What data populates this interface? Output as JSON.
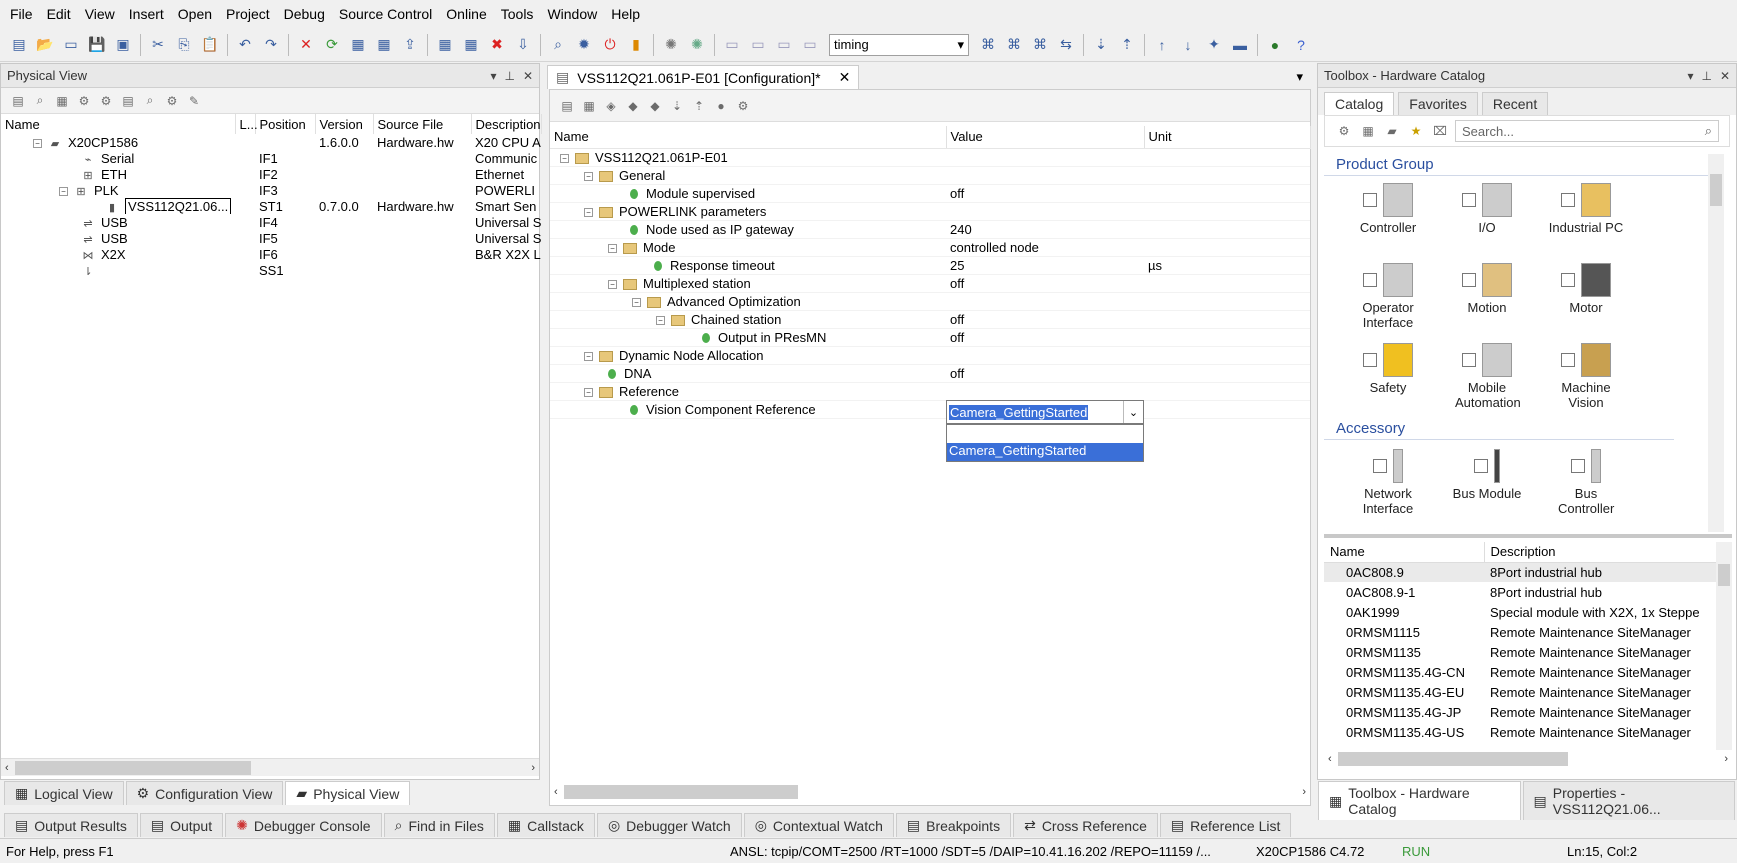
{
  "menu": [
    "File",
    "Edit",
    "View",
    "Insert",
    "Open",
    "Project",
    "Debug",
    "Source Control",
    "Online",
    "Tools",
    "Window",
    "Help"
  ],
  "toolbar": {
    "combo_value": "timing"
  },
  "physical_view": {
    "title": "Physical View",
    "columns": [
      "Name",
      "L...",
      "Position",
      "Version",
      "Source File",
      "Description"
    ],
    "rows": [
      {
        "name": "X20CP1586",
        "position": "",
        "version": "1.6.0.0",
        "source": "Hardware.hw",
        "desc": "X20 CPU A"
      },
      {
        "name": "Serial",
        "position": "IF1",
        "version": "",
        "source": "",
        "desc": "Communic"
      },
      {
        "name": "ETH",
        "position": "IF2",
        "version": "",
        "source": "",
        "desc": "Ethernet"
      },
      {
        "name": "PLK",
        "position": "IF3",
        "version": "",
        "source": "",
        "desc": "POWERLI"
      },
      {
        "name": "VSS112Q21.06...",
        "position": "ST1",
        "version": "0.7.0.0",
        "source": "Hardware.hw",
        "desc": "Smart Sen"
      },
      {
        "name": "USB",
        "position": "IF4",
        "version": "",
        "source": "",
        "desc": "Universal S"
      },
      {
        "name": "USB",
        "position": "IF5",
        "version": "",
        "source": "",
        "desc": "Universal S"
      },
      {
        "name": "X2X",
        "position": "IF6",
        "version": "",
        "source": "",
        "desc": "B&R X2X L"
      },
      {
        "name": "",
        "position": "SS1",
        "version": "",
        "source": "",
        "desc": ""
      }
    ],
    "tabs": [
      "Logical View",
      "Configuration View",
      "Physical View"
    ]
  },
  "config": {
    "tab_title": "VSS112Q21.061P-E01 [Configuration]*",
    "columns": [
      "Name",
      "Value",
      "Unit"
    ],
    "rows": [
      {
        "name": "VSS112Q21.061P-E01",
        "value": "",
        "unit": ""
      },
      {
        "name": "General",
        "value": "",
        "unit": ""
      },
      {
        "name": "Module supervised",
        "value": "off",
        "unit": ""
      },
      {
        "name": "POWERLINK parameters",
        "value": "",
        "unit": ""
      },
      {
        "name": "Node used as IP gateway",
        "value": "240",
        "unit": ""
      },
      {
        "name": "Mode",
        "value": "controlled node",
        "unit": ""
      },
      {
        "name": "Response timeout",
        "value": "25",
        "unit": "µs"
      },
      {
        "name": "Multiplexed station",
        "value": "off",
        "unit": ""
      },
      {
        "name": "Advanced Optimization",
        "value": "",
        "unit": ""
      },
      {
        "name": "Chained station",
        "value": "off",
        "unit": ""
      },
      {
        "name": "Output in PResMN",
        "value": "off",
        "unit": ""
      },
      {
        "name": "Dynamic Node Allocation",
        "value": "",
        "unit": ""
      },
      {
        "name": "DNA",
        "value": "off",
        "unit": ""
      },
      {
        "name": "Reference",
        "value": "",
        "unit": ""
      },
      {
        "name": "Vision Component Reference",
        "value": "",
        "unit": ""
      }
    ],
    "dropdown_value": "Camera_GettingStarted",
    "dropdown_options": [
      "",
      "Camera_GettingStarted"
    ]
  },
  "toolbox": {
    "title": "Toolbox - Hardware Catalog",
    "tabs": [
      "Catalog",
      "Favorites",
      "Recent"
    ],
    "search_placeholder": "Search...",
    "product_group_label": "Product Group",
    "accessory_label": "Accessory",
    "products": [
      "Controller",
      "I/O",
      "Industrial PC",
      "Operator Interface",
      "Motion",
      "Motor",
      "Safety",
      "Mobile Automation",
      "Machine Vision"
    ],
    "accessories": [
      "Network Interface",
      "Bus Module",
      "Bus Controller"
    ],
    "list_columns": [
      "Name",
      "Description"
    ],
    "list": [
      {
        "name": "0AC808.9",
        "desc": "8Port industrial hub"
      },
      {
        "name": "0AC808.9-1",
        "desc": "8Port industrial hub"
      },
      {
        "name": "0AK1999",
        "desc": "Special module with X2X, 1x Steppe"
      },
      {
        "name": "0RMSM1115",
        "desc": "Remote Maintenance SiteManager"
      },
      {
        "name": "0RMSM1135",
        "desc": "Remote Maintenance SiteManager"
      },
      {
        "name": "0RMSM1135.4G-CN",
        "desc": "Remote Maintenance SiteManager"
      },
      {
        "name": "0RMSM1135.4G-EU",
        "desc": "Remote Maintenance SiteManager"
      },
      {
        "name": "0RMSM1135.4G-JP",
        "desc": "Remote Maintenance SiteManager"
      },
      {
        "name": "0RMSM1135.4G-US",
        "desc": "Remote Maintenance SiteManager"
      }
    ],
    "bottom_tabs": [
      "Toolbox - Hardware Catalog",
      "Properties - VSS112Q21.06..."
    ]
  },
  "output_tabs": [
    "Output Results",
    "Output",
    "Debugger Console",
    "Find in Files",
    "Callstack",
    "Debugger Watch",
    "Contextual Watch",
    "Breakpoints",
    "Cross Reference",
    "Reference List"
  ],
  "status": {
    "help": "For Help, press F1",
    "connection": "ANSL: tcpip/COMT=2500 /RT=1000 /SDT=5 /DAIP=10.41.16.202 /REPO=11159 /...",
    "cpu": "X20CP1586  C4.72",
    "mode": "RUN",
    "position": "Ln:15, Col:2"
  }
}
